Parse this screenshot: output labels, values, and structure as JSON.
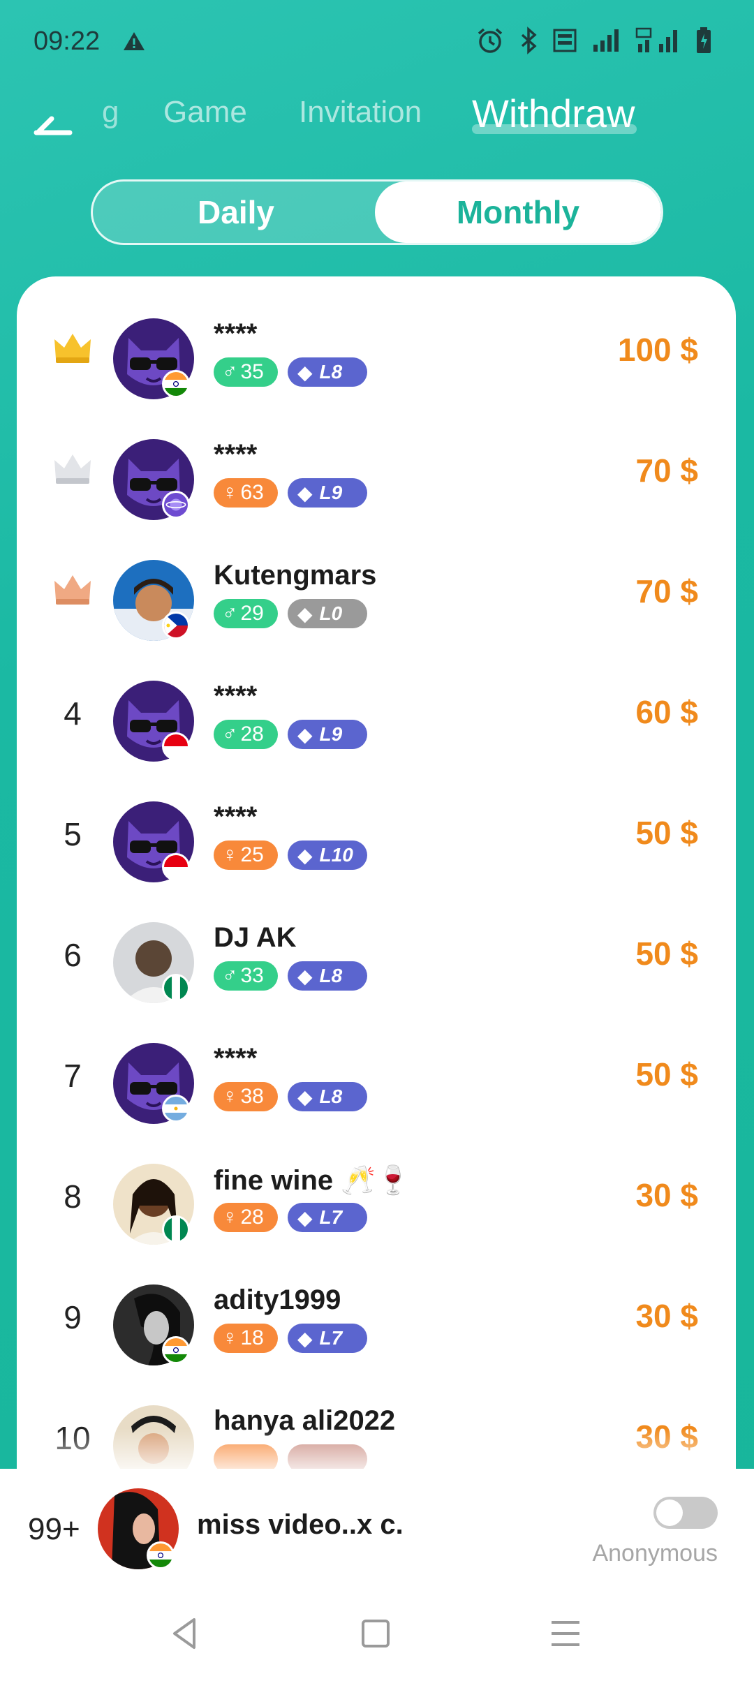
{
  "status_bar": {
    "time": "09:22"
  },
  "header": {
    "tabs": [
      {
        "label": "g"
      },
      {
        "label": "Game"
      },
      {
        "label": "Invitation"
      },
      {
        "label": "Withdraw"
      }
    ]
  },
  "segment": {
    "daily": "Daily",
    "monthly": "Monthly",
    "selected": "Monthly"
  },
  "leaderboard": [
    {
      "rank": "",
      "crown": "gold",
      "name": "****",
      "gender": "male",
      "age": "35",
      "level": "L8",
      "amount": "100 $",
      "flag": "india",
      "avatar": "cat"
    },
    {
      "rank": "",
      "crown": "silver",
      "name": "****",
      "gender": "female",
      "age": "63",
      "level": "L9",
      "amount": "70 $",
      "flag": "planet",
      "avatar": "cat"
    },
    {
      "rank": "",
      "crown": "bronze",
      "name": "Kutengmars",
      "gender": "male",
      "age": "29",
      "level": "L0",
      "amount": "70 $",
      "flag": "philippines",
      "avatar": "photo"
    },
    {
      "rank": "4",
      "name": "****",
      "gender": "male",
      "age": "28",
      "level": "L9",
      "amount": "60 $",
      "flag": "indonesia",
      "avatar": "cat"
    },
    {
      "rank": "5",
      "name": "****",
      "gender": "female",
      "age": "25",
      "level": "L10",
      "amount": "50 $",
      "flag": "indonesia",
      "avatar": "cat"
    },
    {
      "rank": "6",
      "name": "DJ AK",
      "gender": "male",
      "age": "33",
      "level": "L8",
      "amount": "50 $",
      "flag": "nigeria",
      "avatar": "photo"
    },
    {
      "rank": "7",
      "name": "****",
      "gender": "female",
      "age": "38",
      "level": "L8",
      "amount": "50 $",
      "flag": "argentina",
      "avatar": "cat"
    },
    {
      "rank": "8",
      "name": "fine wine 🥂🍷",
      "gender": "female",
      "age": "28",
      "level": "L7",
      "amount": "30 $",
      "flag": "nigeria",
      "avatar": "photo"
    },
    {
      "rank": "9",
      "name": "adity1999",
      "gender": "female",
      "age": "18",
      "level": "L7",
      "amount": "30 $",
      "flag": "india",
      "avatar": "photo"
    },
    {
      "rank": "10",
      "name": "hanya ali2022",
      "gender": "female",
      "age": "",
      "level": "",
      "amount": "30 $",
      "flag": "",
      "avatar": "photo"
    }
  ],
  "me": {
    "rank": "99+",
    "name": "miss video..x c.",
    "flag": "india",
    "anonymous_label": "Anonymous",
    "anonymous_on": false
  },
  "colors": {
    "accent": "#1bb9a3",
    "amount": "#f08a1c",
    "male": "#34cf8a",
    "female": "#f8893a",
    "level": "#5b65cf"
  }
}
